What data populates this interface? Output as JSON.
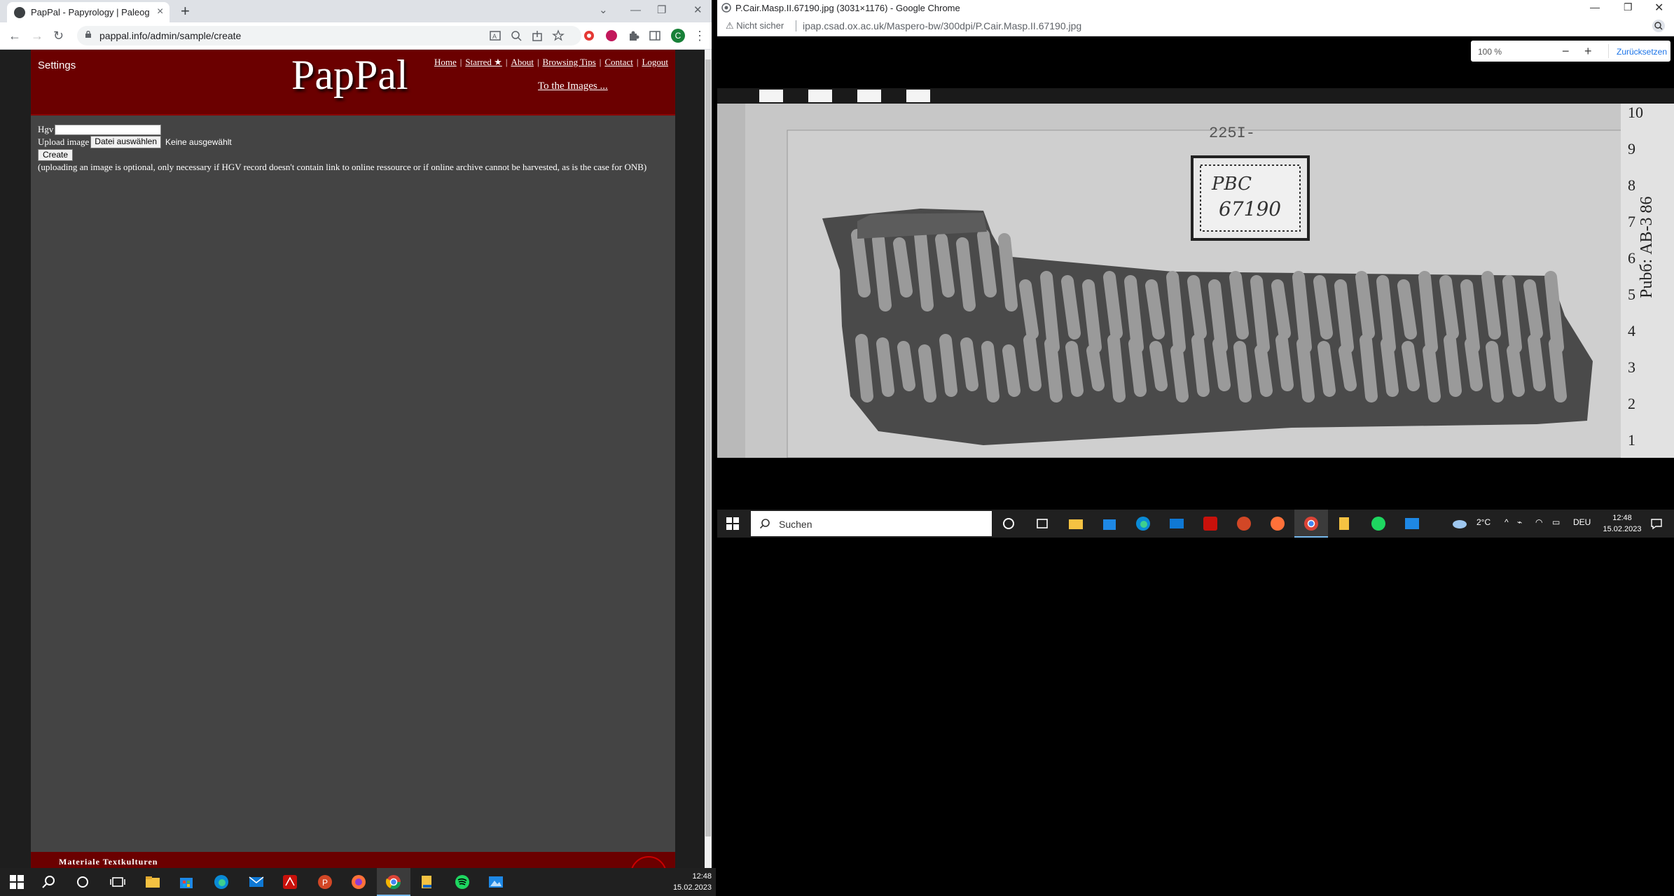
{
  "left_window": {
    "tab_title": "PapPal - Papyrology | Paleograph",
    "url": "pappal.info/admin/sample/create",
    "profile_initial": "C",
    "site": {
      "settings_label": "Settings",
      "logo": "PapPal",
      "menu": [
        "Home",
        "Starred ★",
        "About",
        "Browsing Tips",
        "Contact",
        "Logout"
      ],
      "to_images": "To the Images ...",
      "form": {
        "hgv_label": "Hgv",
        "upload_label": "Upload image",
        "file_button": "Datei auswählen",
        "no_file": "Keine ausgewählt",
        "create_button": "Create",
        "note": "(uploading an image is optional, only necessary if HGV record doesn't contain link to online ressource or if online archive cannot be harvested, as is the case for ONB)"
      },
      "footer_text": "Materiale Textkulturen"
    },
    "taskbar_clock": {
      "time": "12:48",
      "date": "15.02.2023"
    }
  },
  "right_window": {
    "title": "P.Cair.Masp.II.67190.jpg (3031×1176) - Google Chrome",
    "security": "Nicht sicher",
    "url": "ipap.csad.ox.ac.uk/Maspero-bw/300dpi/P.Cair.Masp.II.67190.jpg",
    "zoom": {
      "level": "100 %",
      "minus": "−",
      "plus": "+",
      "reset": "Zurücksetzen"
    },
    "image_labels": {
      "label_top": "225I-",
      "stamp_line1": "PBC",
      "stamp_line2": "67190",
      "ruler_text": "Pubб: AB-3 86",
      "ruler_numbers": [
        "10",
        "9",
        "8",
        "7",
        "6",
        "5",
        "4",
        "3",
        "2",
        "1"
      ]
    }
  },
  "right_taskbar": {
    "search_placeholder": "Suchen",
    "weather": "2°C",
    "language": "DEU",
    "time": "12:48",
    "date": "15.02.2023"
  }
}
